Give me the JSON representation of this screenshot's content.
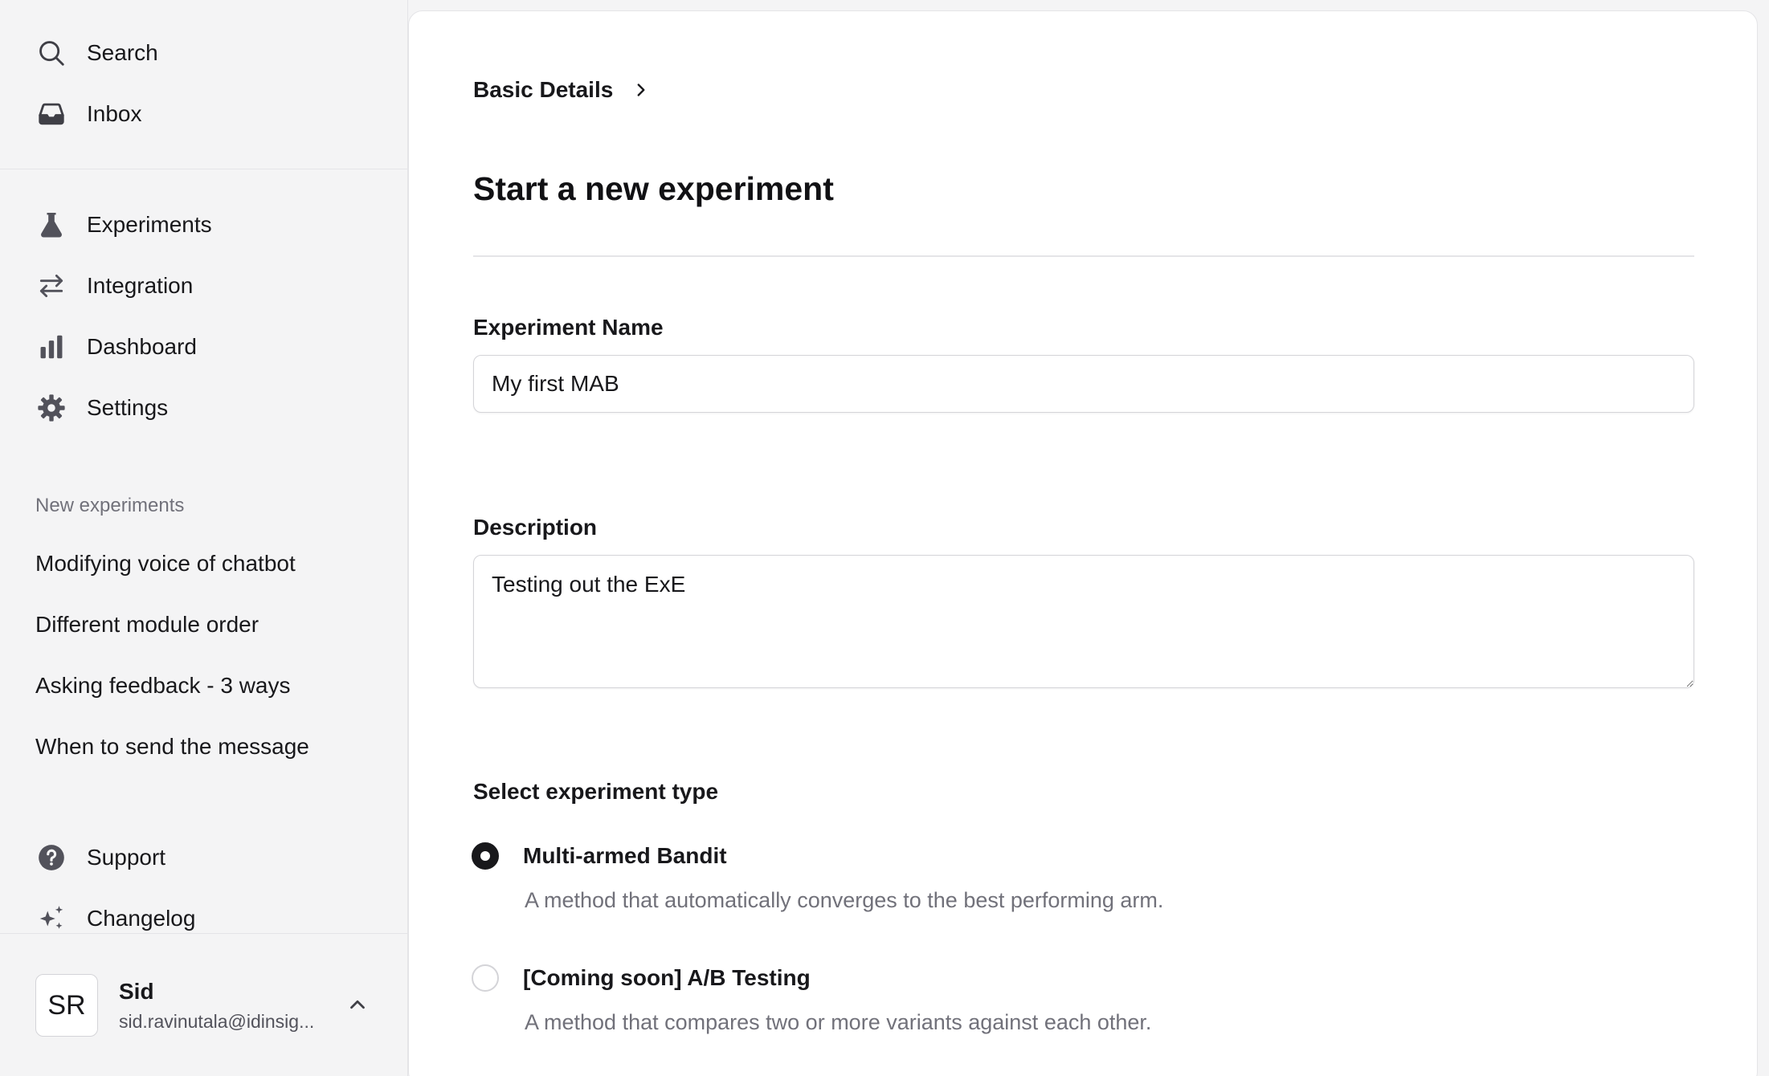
{
  "sidebar": {
    "top_nav": [
      {
        "label": "Search",
        "icon": "search-icon"
      },
      {
        "label": "Inbox",
        "icon": "inbox-icon"
      }
    ],
    "main_nav": [
      {
        "label": "Experiments",
        "icon": "flask-icon"
      },
      {
        "label": "Integration",
        "icon": "arrows-exchange-icon"
      },
      {
        "label": "Dashboard",
        "icon": "bar-chart-icon"
      },
      {
        "label": "Settings",
        "icon": "gear-icon"
      }
    ],
    "section_label": "New experiments",
    "experiments": [
      "Modifying voice of chatbot",
      "Different module order",
      "Asking feedback - 3 ways",
      "When to send the message"
    ],
    "bottom_nav": [
      {
        "label": "Support",
        "icon": "help-circle-icon"
      },
      {
        "label": "Changelog",
        "icon": "sparkles-icon"
      }
    ],
    "user": {
      "initials": "SR",
      "name": "Sid",
      "email": "sid.ravinutala@idinsig..."
    }
  },
  "main": {
    "breadcrumb": "Basic Details",
    "title": "Start a new experiment",
    "name_field": {
      "label": "Experiment Name",
      "value": "My first MAB"
    },
    "description_field": {
      "label": "Description",
      "value": "Testing out the ExE"
    },
    "type_section": {
      "label": "Select experiment type",
      "options": [
        {
          "label": "Multi-armed Bandit",
          "description": "A method that automatically converges to the best performing arm.",
          "selected": true
        },
        {
          "label": "[Coming soon] A/B Testing",
          "description": "A method that compares two or more variants against each other.",
          "selected": false
        }
      ]
    }
  },
  "colors": {
    "sidebar_bg": "#f4f4f5",
    "panel_bg": "#ffffff",
    "text_primary": "#18181b",
    "text_muted": "#71717a",
    "border": "#e4e4e7"
  }
}
